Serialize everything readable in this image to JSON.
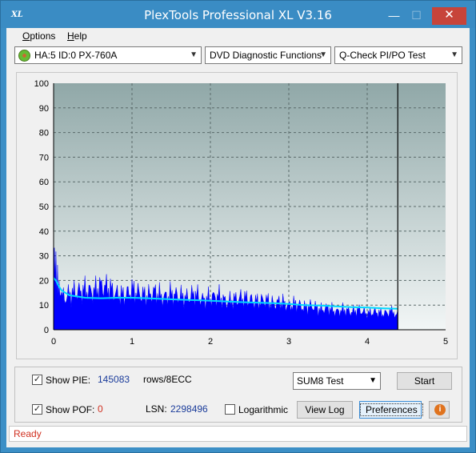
{
  "window": {
    "title": "PlexTools Professional XL V3.16",
    "icon_text": "XL",
    "minimize": "—",
    "maximize": "☐",
    "close": "✕"
  },
  "menu": [
    {
      "label": "Options",
      "u": "O",
      "rest": "ptions"
    },
    {
      "label": "Help",
      "u": "H",
      "rest": "elp"
    }
  ],
  "toolbar": {
    "drive": "HA:5 ID:0  PX-760A",
    "function": "DVD Diagnostic Functions",
    "test": "Q-Check PI/PO Test"
  },
  "chart_data": {
    "type": "area",
    "title": "",
    "xlabel": "",
    "ylabel": "",
    "xlim": [
      0,
      5
    ],
    "ylim": [
      0,
      100
    ],
    "x_ticks": [
      "0",
      "1",
      "2",
      "3",
      "4",
      "5"
    ],
    "y_ticks": [
      "0",
      "10",
      "20",
      "30",
      "40",
      "50",
      "60",
      "70",
      "80",
      "90",
      "100"
    ],
    "end_marker_x": 4.39,
    "grid": true,
    "series": [
      {
        "color": "#0000ff",
        "x": [
          0.0,
          0.02,
          0.04,
          0.06,
          0.08,
          0.1,
          0.15,
          0.2,
          0.3,
          0.4,
          0.5,
          0.6,
          0.7,
          0.8,
          0.9,
          1.0,
          1.1,
          1.2,
          1.3,
          1.4,
          1.5,
          1.6,
          1.7,
          1.8,
          1.9,
          2.0,
          2.1,
          2.2,
          2.3,
          2.4,
          2.5,
          2.6,
          2.7,
          2.8,
          2.9,
          3.0,
          3.1,
          3.2,
          3.3,
          3.4,
          3.5,
          3.6,
          3.7,
          3.8,
          3.9,
          4.0,
          4.1,
          4.2,
          4.3,
          4.39
        ],
        "y": [
          40,
          33,
          26,
          22,
          19,
          17,
          16,
          18,
          19,
          20,
          19,
          22,
          21,
          18,
          17,
          20,
          18,
          17,
          19,
          16,
          18,
          17,
          16,
          18,
          15,
          16,
          17,
          14,
          15,
          16,
          15,
          14,
          15,
          13,
          14,
          12,
          13,
          11,
          12,
          10,
          11,
          9,
          10,
          9,
          10,
          8,
          9,
          8,
          9,
          8
        ]
      },
      {
        "color": "#00d8ff",
        "x": [
          0.0,
          0.03,
          0.06,
          0.1,
          0.15,
          0.2,
          0.3,
          0.4,
          0.6,
          0.8,
          1.0,
          1.2,
          1.4,
          1.6,
          1.8,
          2.0,
          2.2,
          2.4,
          2.6,
          2.8,
          3.0,
          3.2,
          3.4,
          3.6,
          3.8,
          4.0,
          4.2,
          4.39
        ],
        "y": [
          21,
          20,
          18,
          16,
          15,
          14,
          13.5,
          13,
          12.8,
          13,
          13,
          12.8,
          12.5,
          12.2,
          12,
          11.8,
          11.5,
          11.2,
          11,
          10.8,
          10.5,
          10,
          9.8,
          9.5,
          9.2,
          9,
          8.7,
          8.5
        ]
      }
    ]
  },
  "panel": {
    "show_pie_label": "Show PIE:",
    "show_pie_checked": "✓",
    "pie_value": "145083",
    "rows_label": "rows/8ECC",
    "show_poe_label": "Show POF:",
    "show_poe_checked": "✓",
    "poe_value": "0",
    "lsn_label": "LSN:",
    "lsn_value": "2298496",
    "logarithmic_label": "Logarithmic",
    "test_select": "SUM8 Test",
    "start_button": "Start",
    "view_log_button": "View Log",
    "preferences_button": "Preferences",
    "info_icon": "i"
  },
  "status": {
    "text": "Ready",
    "color": "#d03020"
  }
}
